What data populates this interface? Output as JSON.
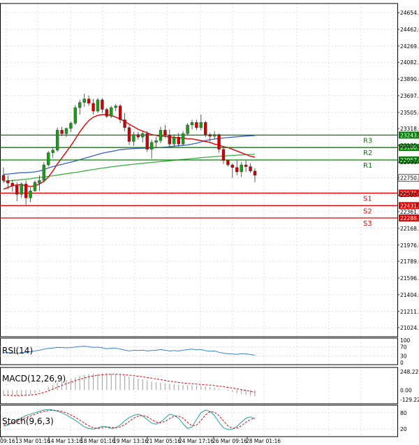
{
  "chart_data": {
    "type": "candlestick",
    "panels": [
      "price",
      "rsi",
      "macd",
      "stoch"
    ],
    "price": {
      "ylim": [
        20920,
        24760
      ],
      "ticks": [
        "24654.3",
        "24462.0",
        "24269.5",
        "24082.5",
        "23890.0",
        "23697.5",
        "23505.0",
        "23318.0",
        "23125.5",
        "22933.0",
        "22750.0",
        "22553.0",
        "22361.0",
        "22168.5",
        "21976.0",
        "21789.0",
        "21596.5",
        "21404.0",
        "21211.5",
        "21024.5"
      ],
      "candles": [
        [
          22780,
          22870,
          22690,
          22720
        ],
        [
          22720,
          22780,
          22620,
          22690
        ],
        [
          22690,
          22730,
          22590,
          22660
        ],
        [
          22660,
          22700,
          22480,
          22560
        ],
        [
          22560,
          22700,
          22520,
          22680
        ],
        [
          22680,
          22720,
          22440,
          22520
        ],
        [
          22520,
          22640,
          22470,
          22600
        ],
        [
          22600,
          22720,
          22590,
          22700
        ],
        [
          22690,
          22780,
          22600,
          22720
        ],
        [
          22720,
          22930,
          22700,
          22900
        ],
        [
          22900,
          23060,
          22880,
          23040
        ],
        [
          23040,
          23100,
          22980,
          23070
        ],
        [
          23070,
          23330,
          23050,
          23300
        ],
        [
          23300,
          23340,
          23230,
          23260
        ],
        [
          23260,
          23330,
          23220,
          23320
        ],
        [
          23320,
          23400,
          23280,
          23380
        ],
        [
          23380,
          23590,
          23360,
          23560
        ],
        [
          23560,
          23650,
          23480,
          23620
        ],
        [
          23620,
          23720,
          23570,
          23660
        ],
        [
          23660,
          23700,
          23580,
          23610
        ],
        [
          23610,
          23660,
          23480,
          23520
        ],
        [
          23520,
          23670,
          23500,
          23650
        ],
        [
          23650,
          23670,
          23500,
          23540
        ],
        [
          23540,
          23560,
          23440,
          23460
        ],
        [
          23460,
          23580,
          23440,
          23560
        ],
        [
          23560,
          23600,
          23520,
          23580
        ],
        [
          23580,
          23600,
          23380,
          23420
        ],
        [
          23420,
          23500,
          23290,
          23330
        ],
        [
          23330,
          23360,
          23130,
          23170
        ],
        [
          23170,
          23280,
          23120,
          23250
        ],
        [
          23250,
          23280,
          23190,
          23220
        ],
        [
          23220,
          23290,
          23160,
          23260
        ],
        [
          23260,
          23290,
          23050,
          23080
        ],
        [
          23080,
          23190,
          22970,
          23160
        ],
        [
          23160,
          23220,
          23100,
          23180
        ],
        [
          23180,
          23340,
          23150,
          23300
        ],
        [
          23300,
          23360,
          23210,
          23240
        ],
        [
          23240,
          23310,
          23110,
          23140
        ],
        [
          23140,
          23250,
          23110,
          23220
        ],
        [
          23220,
          23270,
          23110,
          23140
        ],
        [
          23140,
          23290,
          23120,
          23260
        ],
        [
          23260,
          23380,
          23240,
          23360
        ],
        [
          23360,
          23420,
          23310,
          23390
        ],
        [
          23390,
          23420,
          23300,
          23330
        ],
        [
          23330,
          23480,
          23300,
          23390
        ],
        [
          23390,
          23410,
          23220,
          23250
        ],
        [
          23250,
          23270,
          23170,
          23230
        ],
        [
          23230,
          23290,
          23200,
          23250
        ],
        [
          23250,
          23260,
          23040,
          23080
        ],
        [
          23080,
          23100,
          22910,
          22950
        ],
        [
          22950,
          22960,
          22880,
          22900
        ],
        [
          22900,
          22920,
          22750,
          22870
        ],
        [
          22870,
          22950,
          22780,
          22820
        ],
        [
          22820,
          22930,
          22760,
          22900
        ],
        [
          22900,
          22950,
          22820,
          22880
        ],
        [
          22880,
          22920,
          22810,
          22830
        ],
        [
          22830,
          22860,
          22700,
          22780
        ]
      ],
      "ma_red": [
        22620,
        22640,
        22660,
        22670,
        22670,
        22660,
        22650,
        22660,
        22680,
        22710,
        22760,
        22830,
        22910,
        22980,
        23050,
        23120,
        23200,
        23280,
        23350,
        23410,
        23450,
        23470,
        23480,
        23480,
        23470,
        23450,
        23430,
        23400,
        23370,
        23340,
        23310,
        23290,
        23270,
        23250,
        23240,
        23230,
        23230,
        23220,
        23220,
        23210,
        23210,
        23200,
        23200,
        23190,
        23180,
        23170,
        23160,
        23140,
        23130,
        23110,
        23100,
        23080,
        23060,
        23040,
        23020,
        23000,
        22990
      ],
      "ma_blue": [
        22790,
        22795,
        22800,
        22805,
        22810,
        22810,
        22815,
        22820,
        22830,
        22845,
        22865,
        22880,
        22895,
        22905,
        22920,
        22930,
        22945,
        22960,
        22975,
        22990,
        23005,
        23020,
        23035,
        23045,
        23055,
        23065,
        23075,
        23080,
        23085,
        23088,
        23090,
        23092,
        23094,
        23096,
        23098,
        23100,
        23105,
        23110,
        23115,
        23120,
        23125,
        23130,
        23140,
        23150,
        23165,
        23180,
        23190,
        23198,
        23205,
        23210,
        23215,
        23220,
        23225,
        23228,
        23232,
        23235,
        23238
      ],
      "ma_green": [
        22710,
        22715,
        22720,
        22725,
        22730,
        22735,
        22740,
        22750,
        22755,
        22762,
        22768,
        22775,
        22782,
        22790,
        22798,
        22805,
        22813,
        22821,
        22830,
        22838,
        22847,
        22855,
        22863,
        22870,
        22877,
        22884,
        22890,
        22896,
        22902,
        22908,
        22913,
        22918,
        22923,
        22928,
        22933,
        22938,
        22943,
        22948,
        22953,
        22958,
        22963,
        22968,
        22973,
        22978,
        22983,
        22988,
        22992,
        22996,
        23000,
        23003,
        23006,
        23009,
        23012,
        23015,
        23018,
        23020,
        23022
      ],
      "current_price_label": "22750.0"
    },
    "support_resistance": [
      {
        "name": "R3",
        "value": 23243.4,
        "label": "23243.4",
        "color": "#008000"
      },
      {
        "name": "R2",
        "value": 23100.2,
        "label": "23100.2",
        "color": "#008000"
      },
      {
        "name": "R1",
        "value": 22957.0,
        "label": "22957.0",
        "color": "#008000"
      },
      {
        "name": "S1",
        "value": 22575.0,
        "label": "22575.0",
        "color": "#e00000"
      },
      {
        "name": "S2",
        "value": 22431.0,
        "label": "22431.0",
        "color": "#e00000"
      },
      {
        "name": "S3",
        "value": 22288.6,
        "label": "22288.6",
        "color": "#e00000"
      }
    ],
    "rsi": {
      "title": "RSI(14)",
      "ylim": [
        0,
        100
      ],
      "ticks": [
        "100",
        "70",
        "30",
        "0"
      ],
      "values": [
        45,
        44,
        43,
        42,
        44,
        46,
        48,
        52,
        55,
        60,
        63,
        65,
        68,
        67,
        66,
        67,
        70,
        72,
        73,
        71,
        68,
        69,
        66,
        62,
        64,
        65,
        60,
        56,
        52,
        55,
        54,
        56,
        52,
        54,
        55,
        58,
        55,
        52,
        54,
        52,
        55,
        58,
        60,
        57,
        58,
        53,
        51,
        52,
        46,
        42,
        40,
        38,
        37,
        40,
        39,
        36,
        33
      ]
    },
    "macd": {
      "title": "MACD(12,26,9)",
      "ticks": [
        "248.22",
        "0.00",
        "-129.22"
      ],
      "hist": [
        -60,
        -65,
        -70,
        -75,
        -72,
        -70,
        -60,
        -40,
        -20,
        10,
        40,
        70,
        100,
        120,
        135,
        150,
        170,
        190,
        205,
        215,
        220,
        222,
        225,
        225,
        222,
        218,
        210,
        195,
        180,
        168,
        155,
        145,
        130,
        115,
        105,
        100,
        90,
        80,
        75,
        68,
        65,
        64,
        66,
        60,
        58,
        50,
        40,
        30,
        15,
        0,
        -15,
        -30,
        -45,
        -55,
        -65,
        -75,
        -85
      ],
      "signal": [
        -70,
        -72,
        -74,
        -75,
        -74,
        -72,
        -68,
        -60,
        -48,
        -32,
        -12,
        12,
        38,
        62,
        85,
        106,
        126,
        145,
        162,
        177,
        190,
        199,
        206,
        211,
        213,
        213,
        211,
        207,
        201,
        194,
        186,
        178,
        169,
        160,
        150,
        140,
        130,
        120,
        111,
        103,
        96,
        90,
        85,
        80,
        76,
        71,
        66,
        60,
        53,
        45,
        36,
        26,
        16,
        5,
        -6,
        -17,
        -28
      ]
    },
    "stoch": {
      "title": "Stoch(9,6,3)",
      "ticks": [
        "80",
        "20"
      ],
      "k": [
        30,
        35,
        45,
        55,
        60,
        70,
        75,
        80,
        85,
        90,
        92,
        90,
        86,
        80,
        72,
        62,
        52,
        40,
        28,
        22,
        20,
        24,
        30,
        28,
        22,
        25,
        35,
        50,
        62,
        70,
        75,
        68,
        55,
        42,
        38,
        46,
        60,
        75,
        70,
        60,
        40,
        22,
        28,
        55,
        80,
        90,
        85,
        70,
        45,
        25,
        18,
        20,
        30,
        45,
        60,
        65,
        58
      ],
      "d": [
        35,
        38,
        42,
        48,
        55,
        62,
        68,
        74,
        80,
        85,
        88,
        89,
        88,
        85,
        80,
        72,
        63,
        53,
        42,
        32,
        25,
        22,
        25,
        28,
        26,
        25,
        28,
        36,
        48,
        60,
        68,
        70,
        65,
        55,
        46,
        43,
        48,
        58,
        68,
        68,
        60,
        45,
        32,
        35,
        52,
        72,
        84,
        82,
        70,
        50,
        32,
        22,
        24,
        32,
        45,
        55,
        60
      ]
    },
    "x_labels": [
      "09:16",
      "13 Mar 01:16",
      "14 Mar 13:16",
      "18 Mar 01:16",
      "19 Mar 13:16",
      "21 Mar 05:16",
      "24 Mar 17:16",
      "26 Mar 09:16",
      "28 Mar 01:16"
    ]
  }
}
